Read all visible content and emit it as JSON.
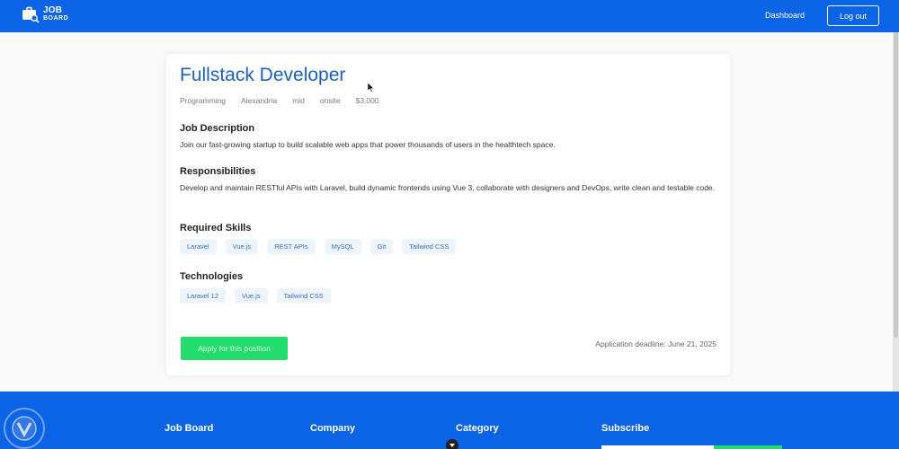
{
  "navbar": {
    "logo_line1": "JOB",
    "logo_line2": "BOARD",
    "dashboard_label": "Dashboard",
    "logout_label": "Log out"
  },
  "job": {
    "title": "Fullstack Developer",
    "meta": [
      "Programming",
      "Alexandria",
      "mid",
      "onsite",
      "$3,000"
    ],
    "description_heading": "Job Description",
    "description": "Join our fast-growing startup to build scalable web apps that power thousands of users in the healthtech space.",
    "responsibilities_heading": "Responsibilities",
    "responsibilities": "Develop and maintain RESTful APIs with Laravel, build dynamic frontends using Vue 3, collaborate with designers and DevOps, write clean and testable code.",
    "skills_heading": "Required Skills",
    "skills": [
      "Laravel",
      "Vue.js",
      "REST APIs",
      "MySQL",
      "Git",
      "Tailwind CSS"
    ],
    "technologies_heading": "Technologies",
    "technologies": [
      "Laravel 12",
      "Vue.js",
      "Tailwind CSS"
    ],
    "apply_label": "Apply for this position",
    "deadline": "Application deadline: June 21, 2025"
  },
  "footer": {
    "columns": [
      "Job Board",
      "Company",
      "Category",
      "Subscribe"
    ]
  },
  "colors": {
    "brand_blue": "#0b63e5",
    "title_blue": "#1a5fc2",
    "apply_green": "#22dd6e"
  }
}
